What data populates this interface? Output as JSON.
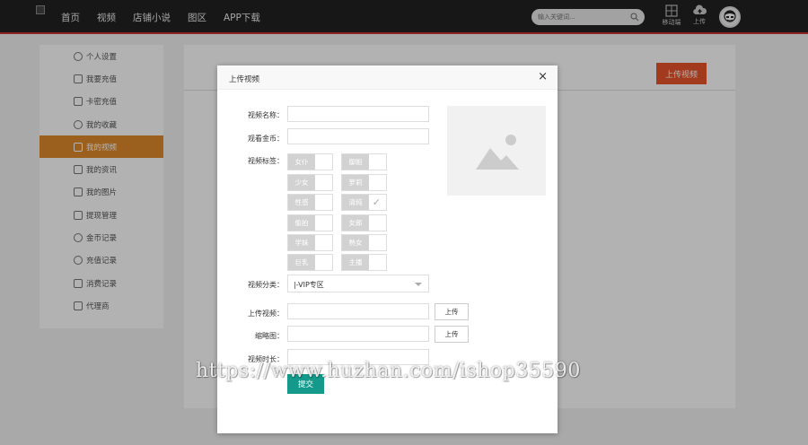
{
  "nav": {
    "items": [
      "首页",
      "视频",
      "店铺小说",
      "图区",
      "APP下载"
    ],
    "search_placeholder": "输入关键词...",
    "mobile_label": "移动端",
    "upload_label": "上传"
  },
  "sidebar": {
    "items": [
      {
        "label": "个人设置",
        "icon": "user-icon"
      },
      {
        "label": "我要充值",
        "icon": "coin-bag-icon"
      },
      {
        "label": "卡密充值",
        "icon": "card-icon"
      },
      {
        "label": "我的收藏",
        "icon": "star-icon"
      },
      {
        "label": "我的视频",
        "icon": "video-icon",
        "active": true
      },
      {
        "label": "我的资讯",
        "icon": "book-icon"
      },
      {
        "label": "我的图片",
        "icon": "image-icon"
      },
      {
        "label": "提现管理",
        "icon": "wallet-icon"
      },
      {
        "label": "金币记录",
        "icon": "coin-icon"
      },
      {
        "label": "充值记录",
        "icon": "recharge-icon"
      },
      {
        "label": "消费记录",
        "icon": "receipt-icon"
      },
      {
        "label": "代理商",
        "icon": "network-icon"
      }
    ]
  },
  "content": {
    "upload_video_button": "上传视频"
  },
  "modal": {
    "title": "上传视频",
    "close": "×",
    "labels": {
      "video_name": "视频名称：",
      "watch_coins": "观看金币：",
      "video_tags": "视频标签：",
      "category": "视频分类：",
      "upload_video": "上传视频：",
      "thumbnail": "缩略图：",
      "duration": "视频时长："
    },
    "tags": [
      {
        "label": "女仆",
        "checked": false
      },
      {
        "label": "御姐",
        "checked": false
      },
      {
        "label": "少女",
        "checked": false
      },
      {
        "label": "萝莉",
        "checked": false
      },
      {
        "label": "性感",
        "checked": false
      },
      {
        "label": "清纯",
        "checked": true
      },
      {
        "label": "偷拍",
        "checked": false
      },
      {
        "label": "女郎",
        "checked": false
      },
      {
        "label": "学妹",
        "checked": false
      },
      {
        "label": "熟女",
        "checked": false
      },
      {
        "label": "巨乳",
        "checked": false
      },
      {
        "label": "主播",
        "checked": false
      }
    ],
    "category_value": "|-VIP专区",
    "upload_button": "上传",
    "thumb_upload_button": "上传",
    "submit_button": "提交"
  },
  "watermark": "https://www.huzhan.com/ishop35590"
}
